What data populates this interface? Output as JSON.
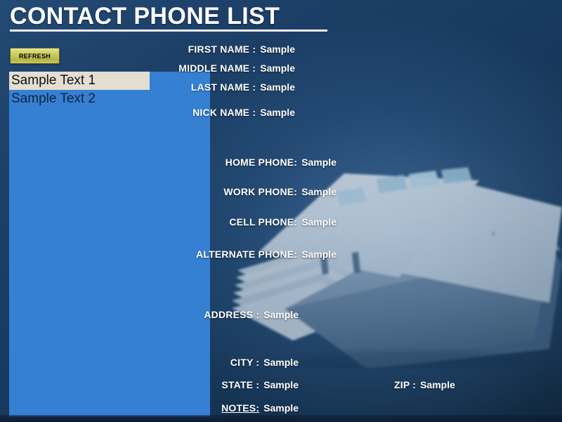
{
  "page": {
    "title": "CONTACT PHONE LIST",
    "accent_blue": "#3580d3",
    "background_navy": "#173a5f",
    "button_olive": "#c3c558",
    "selection_beige": "#e3ded1",
    "text_white": "#ffffff"
  },
  "sidebar": {
    "refresh_button": "REFRESH",
    "list_items": [
      {
        "label": "Sample Text 1",
        "selected": true
      },
      {
        "label": "Sample Text 2",
        "selected": false
      }
    ]
  },
  "details": {
    "name_section": [
      {
        "label": "FIRST NAME :",
        "value": "Sample"
      },
      {
        "label": "MIDDLE NAME :",
        "value": "Sample"
      },
      {
        "label": "LAST NAME :",
        "value": "Sample"
      },
      {
        "label": "NICK NAME :",
        "value": "Sample"
      }
    ],
    "phone_section": [
      {
        "label": "HOME PHONE:",
        "value": "Sample"
      },
      {
        "label": "WORK PHONE:",
        "value": "Sample"
      },
      {
        "label": "CELL PHONE:",
        "value": "Sample"
      },
      {
        "label": "ALTERNATE PHONE:",
        "value": "Sample"
      }
    ],
    "address_section": [
      {
        "label": "ADDRESS :",
        "value": "Sample"
      },
      {
        "label": "CITY :",
        "value": "Sample"
      },
      {
        "label": "STATE :",
        "value": "Sample"
      },
      {
        "label": "NOTES:",
        "value": "Sample",
        "underline": true
      }
    ],
    "zip": {
      "label": "ZIP :",
      "value": "Sample"
    }
  },
  "decoration": {
    "rolodex_icon": "rolodex-card-file-image"
  }
}
